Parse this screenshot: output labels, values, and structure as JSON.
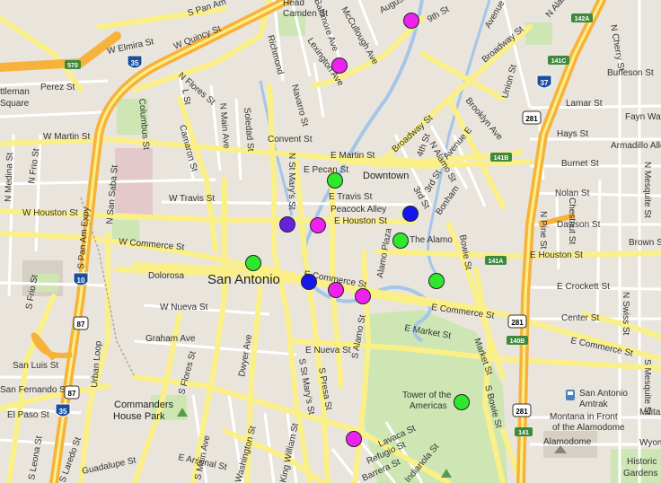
{
  "map": {
    "city_label": "San Antonio",
    "district_label": "Downtown",
    "street_labels": {
      "s_pan_am": "S Pan Am",
      "w_quincy": "W Quincy St",
      "w_elmira": "W Elmira St",
      "perez": "Perez St",
      "ttleman": "ttleman",
      "square": "Square",
      "n_flores": "N Flores St",
      "l_st": "L St",
      "n_main": "N Main Ave",
      "soledad": "Soledad St",
      "camaron": "Camaron St",
      "columbus": "Columbus St",
      "w_martin": "W Martin St",
      "convent": "Convent St",
      "e_martin": "E Martin St",
      "e_pecan": "E Pecan St",
      "e_travis": "E Travis St",
      "w_travis": "W Travis St",
      "w_houston": "W Houston St",
      "e_houston_w": "E Houston St",
      "peacock_alley": "Peacock Alley",
      "w_commerce": "W Commerce St",
      "dolorosa": "Dolorosa",
      "e_commerce_mid": "E Commerce St",
      "e_commerce_right": "E Commerce St",
      "e_commerce_far": "E Commerce St",
      "w_nueva": "W Nueva St",
      "e_nueva": "E Nueva St",
      "graham": "Graham Ave",
      "s_flores": "S Flores St",
      "dwyer": "Dwyer Ave",
      "s_st_marys": "S St Mary's St",
      "s_presa": "S Presa St",
      "s_alamo": "S Alamo St",
      "s_bowie": "S Bowie St",
      "bowie": "Bowie St",
      "market": "Market St",
      "e_market": "E Market St",
      "e_houston_e": "E Houston St",
      "e_crockett": "E Crockett St",
      "center": "Center St",
      "nolan": "Nolan St",
      "dawson": "Dawson St",
      "brown": "Brown St",
      "hays": "Hays St",
      "burnet": "Burnet St",
      "lamar": "Lamar St",
      "burleson": "Burleson St",
      "fayn_way": "Fayn Way",
      "armadillo": "Armadillo Alley",
      "n_cherry": "N Cherry St",
      "n_mesquite": "N Mesquite St",
      "s_mesquite": "S Mesquite St",
      "n_swiss": "N Swiss St",
      "chestnut": "Chestnut St",
      "n_pine": "N Pine St",
      "n_alamo_top": "N Alamo St",
      "n_alamo_mid": "N Alamo St",
      "avenue_e": "Avenue E",
      "fourth": "4th St",
      "third_a": "3rd St",
      "third_b": "3rd St",
      "bonham": "Bonham",
      "alamo_plaza": "Alamo Plaza",
      "broadway": "Broadway St",
      "broadway_top": "Broadway St",
      "brooklyn": "Brooklyn Ave",
      "union": "Union St",
      "avenue_b": "Avenue B",
      "ninth": "9th St",
      "augusta": "Augusta",
      "mccullough": "McCullough Ave",
      "baltimore": "Baltimore Ave",
      "camden": "Camden St",
      "head": "Head",
      "richmond": "Richmond",
      "lexington": "Lexington Ave",
      "navarro": "Navarro St",
      "n_st_marys": "N St Mary's St",
      "n_frio": "N Frio St",
      "s_frio": "S Frio St",
      "n_medina": "N Medina St",
      "n_san_saba": "N San Saba St",
      "s_pan_am_expy": "S Pan Am Expy",
      "urban_loop": "Urban Loop",
      "s_laredo": "S Laredo St",
      "s_leona": "S Leona St",
      "san_luis": "San Luis St",
      "san_fernando": "San Fernando St",
      "el_paso": "El Paso St",
      "guadalupe": "Guadalupe St",
      "s_main": "S Main Ave",
      "e_arsenal": "E Arsenal St",
      "washington": "Washington St",
      "king_william": "King William St",
      "lavaca": "Lavaca St",
      "refugio": "Refugio St",
      "barrera": "Barrera St",
      "indianola": "Indianola St",
      "wyoming": "Wyom",
      "military": "Militar"
    },
    "poi_labels": {
      "the_alamo": "The Alamo",
      "tower_line1": "Tower of the",
      "tower_line2": "Americas",
      "commanders_line1": "Commanders",
      "commanders_line2": "House Park",
      "amtrak_line1": "San Antonio",
      "amtrak_line2": "Amtrak",
      "montana_line1": "Montana in Front",
      "montana_line2": "of the Alamodome",
      "alamodome": "Alamodome",
      "historic_line1": "Historic",
      "historic_line2": "Gardens"
    },
    "shields": {
      "i10_top": "10",
      "i10_bottom": "10",
      "i35_top": "35",
      "i35_bottom": "35",
      "i37": "37",
      "us87_a": "87",
      "us87_b": "87",
      "us281_a": "281",
      "us281_b": "281",
      "us281_c": "281",
      "exit_570": "570",
      "exit_142a": "142A",
      "exit_141c": "141C",
      "exit_141b": "141B",
      "exit_141a": "141A",
      "exit_140b": "140B",
      "exit_141": "141"
    },
    "marker_colors": {
      "green": "#2ee82e",
      "magenta": "#ee22ee",
      "blue": "#1515ee",
      "purple": "#6622dd"
    },
    "markers": [
      {
        "color": "magenta"
      },
      {
        "color": "magenta"
      },
      {
        "color": "green"
      },
      {
        "color": "blue"
      },
      {
        "color": "purple"
      },
      {
        "color": "magenta"
      },
      {
        "color": "green"
      },
      {
        "color": "green"
      },
      {
        "color": "blue"
      },
      {
        "color": "magenta"
      },
      {
        "color": "magenta"
      },
      {
        "color": "green"
      },
      {
        "color": "green"
      },
      {
        "color": "magenta"
      }
    ]
  }
}
